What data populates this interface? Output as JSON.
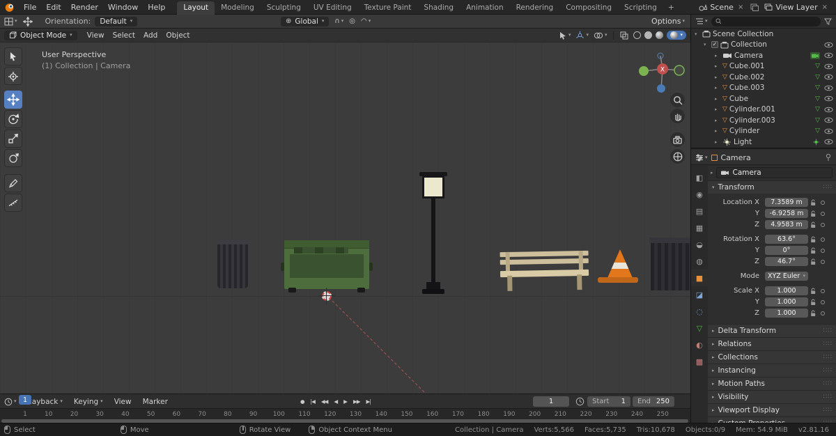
{
  "palette": {
    "accent": "#4772b3",
    "object_orange": "#e8913a",
    "data_green": "#54b948",
    "viewport_bg": "#3c3c3c"
  },
  "icons": {
    "chevron_down": "▾",
    "disclosure_collapsed": "▸",
    "disclosure_expanded": "▾",
    "grip": "∷∷",
    "mesh_triangle": "▽",
    "check": "✓",
    "close": "×",
    "globe": "⊕",
    "magnet": "∩",
    "proportional": "◎",
    "falloff": "◠",
    "add": "+"
  },
  "topbar": {
    "menus": [
      "File",
      "Edit",
      "Render",
      "Window",
      "Help"
    ],
    "workspaces": [
      {
        "label": "Layout",
        "active": true
      },
      {
        "label": "Modeling"
      },
      {
        "label": "Sculpting"
      },
      {
        "label": "UV Editing"
      },
      {
        "label": "Texture Paint"
      },
      {
        "label": "Shading"
      },
      {
        "label": "Animation"
      },
      {
        "label": "Rendering"
      },
      {
        "label": "Compositing"
      },
      {
        "label": "Scripting"
      }
    ],
    "add_workspace": "+",
    "scene_label": "Scene",
    "view_layer_label": "View Layer"
  },
  "toolbar": {
    "orientation_label": "Orientation:",
    "orientation_value": "Default",
    "pivot": "Global",
    "options_label": "Options"
  },
  "viewport": {
    "mode": "Object Mode",
    "menus": [
      "View",
      "Select",
      "Add",
      "Object"
    ],
    "overlay_line1": "User Perspective",
    "overlay_line2": "(1) Collection | Camera",
    "gizmo_x": "X"
  },
  "outliner": {
    "search_value": "",
    "rows": [
      {
        "label": "Scene Collection",
        "type": "collection",
        "level": 0,
        "flags": [
          "root"
        ]
      },
      {
        "label": "Collection",
        "type": "collection",
        "level": 1,
        "flags": [
          "checkbox"
        ]
      },
      {
        "label": "Camera",
        "type": "camera",
        "level": 2
      },
      {
        "label": "Cube.001",
        "type": "mesh",
        "level": 2
      },
      {
        "label": "Cube.002",
        "type": "mesh",
        "level": 2
      },
      {
        "label": "Cube.003",
        "type": "mesh",
        "level": 2
      },
      {
        "label": "Cube",
        "type": "mesh",
        "level": 2
      },
      {
        "label": "Cylinder.001",
        "type": "mesh",
        "level": 2
      },
      {
        "label": "Cylinder.003",
        "type": "mesh",
        "level": 2
      },
      {
        "label": "Cylinder",
        "type": "mesh",
        "level": 2
      },
      {
        "label": "Light",
        "type": "light",
        "level": 2
      }
    ]
  },
  "properties": {
    "breadcrumb": "Camera",
    "id_name": "Camera",
    "tabs": [
      {
        "name": "tool",
        "glyph": "◧",
        "color": "#a0a0a0"
      },
      {
        "name": "render",
        "glyph": "◉",
        "color": "#a0a0a0"
      },
      {
        "name": "output",
        "glyph": "▤",
        "color": "#a0a0a0"
      },
      {
        "name": "view-layer",
        "glyph": "▦",
        "color": "#a0a0a0"
      },
      {
        "name": "scene",
        "glyph": "◒",
        "color": "#a0a0a0"
      },
      {
        "name": "world",
        "glyph": "◍",
        "color": "#a0a0a0"
      },
      {
        "name": "object",
        "glyph": "■",
        "color": "#e8913a",
        "active": true
      },
      {
        "name": "modifiers",
        "glyph": "◪",
        "color": "#7da7d9"
      },
      {
        "name": "physics",
        "glyph": "◌",
        "color": "#7da7d9"
      },
      {
        "name": "object-data",
        "glyph": "▽",
        "color": "#54b948"
      },
      {
        "name": "material",
        "glyph": "◐",
        "color": "#c87a7a"
      },
      {
        "name": "texture",
        "glyph": "▩",
        "color": "#c87a7a"
      }
    ],
    "transform": {
      "title": "Transform",
      "location_rows": [
        {
          "label": "Location X",
          "value": "7.3589 m"
        },
        {
          "label": "Y",
          "value": "-6.9258 m"
        },
        {
          "label": "Z",
          "value": "4.9583 m"
        }
      ],
      "rotation_rows": [
        {
          "label": "Rotation X",
          "value": "63.6°"
        },
        {
          "label": "Y",
          "value": "0°"
        },
        {
          "label": "Z",
          "value": "46.7°"
        }
      ],
      "mode_label": "Mode",
      "mode_value": "XYZ Euler",
      "scale_rows": [
        {
          "label": "Scale X",
          "value": "1.000"
        },
        {
          "label": "Y",
          "value": "1.000"
        },
        {
          "label": "Z",
          "value": "1.000"
        }
      ]
    },
    "sections": [
      "Delta Transform",
      "Relations",
      "Collections",
      "Instancing",
      "Motion Paths",
      "Visibility",
      "Viewport Display",
      "Custom Properties"
    ]
  },
  "timeline": {
    "menus": [
      "Playback",
      "Keying",
      "View",
      "Marker"
    ],
    "transport": [
      {
        "name": "record",
        "glyph": "●"
      },
      {
        "name": "jump-start",
        "glyph": "|◀"
      },
      {
        "name": "prev-keyframe",
        "glyph": "◀◀"
      },
      {
        "name": "play-reverse",
        "glyph": "◀"
      },
      {
        "name": "play",
        "glyph": "▶"
      },
      {
        "name": "next-keyframe",
        "glyph": "▶▶"
      },
      {
        "name": "jump-end",
        "glyph": "▶|"
      }
    ],
    "current_frame": "1",
    "start_label": "Start",
    "start": "1",
    "end_label": "End",
    "end": "250",
    "ticks": [
      "1",
      "10",
      "20",
      "30",
      "40",
      "50",
      "60",
      "70",
      "80",
      "90",
      "100",
      "110",
      "120",
      "130",
      "140",
      "150",
      "160",
      "170",
      "180",
      "190",
      "200",
      "210",
      "220",
      "230",
      "240",
      "250"
    ]
  },
  "statusbar": {
    "left": [
      {
        "label": "Select",
        "flags": [
          "lmb"
        ]
      },
      {
        "label": "Move",
        "flags": [
          "lmb"
        ]
      },
      {
        "label": "Rotate View",
        "flags": [
          "mmb"
        ]
      },
      {
        "label": "Object Context Menu",
        "flags": [
          "rmb"
        ]
      }
    ],
    "right": [
      "Collection | Camera",
      "Verts:5,566",
      "Faces:5,735",
      "Tris:10,678",
      "Objects:0/9",
      "Mem: 54.9 MiB",
      "v2.81.16"
    ]
  }
}
